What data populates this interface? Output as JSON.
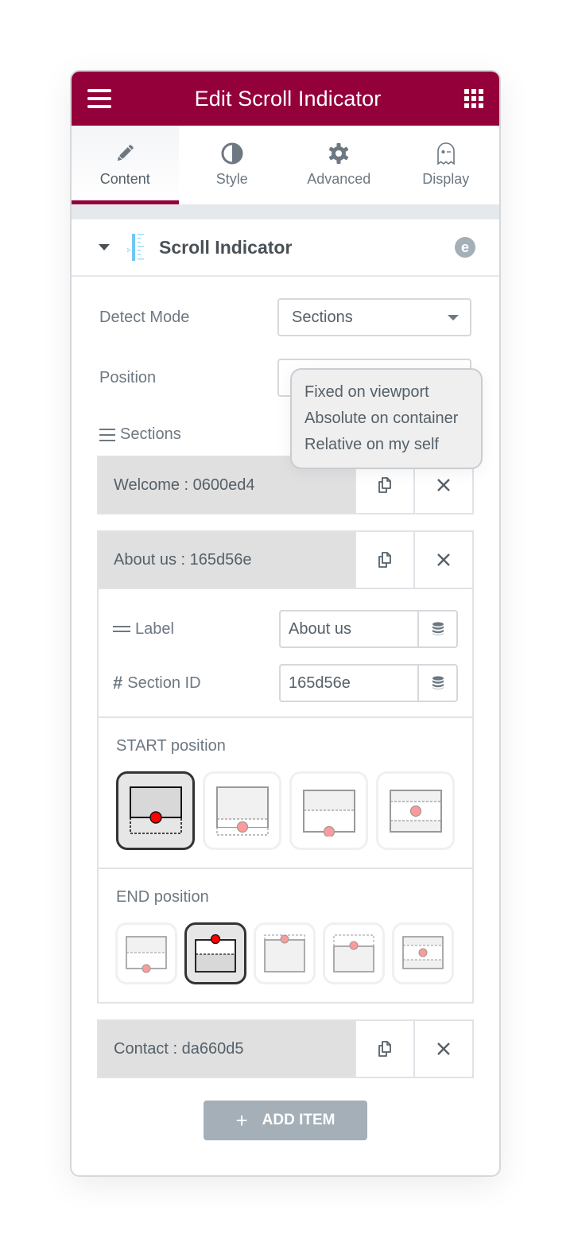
{
  "header": {
    "title": "Edit Scroll Indicator",
    "menu_icon": "hamburger-icon",
    "apps_icon": "grid-icon"
  },
  "tabs": [
    {
      "label": "Content",
      "icon": "pencil-icon",
      "active": true
    },
    {
      "label": "Style",
      "icon": "half-circle-icon",
      "active": false
    },
    {
      "label": "Advanced",
      "icon": "gear-icon",
      "active": false
    },
    {
      "label": "Display",
      "icon": "ghost-icon",
      "active": false
    }
  ],
  "widget": {
    "title": "Scroll Indicator",
    "badge": "e"
  },
  "controls": {
    "detect_mode": {
      "label": "Detect Mode",
      "value": "Sections"
    },
    "position": {
      "label": "Position",
      "options": [
        "Fixed on viewport",
        "Absolute on container",
        "Relative on my self"
      ]
    },
    "sections_label": "Sections"
  },
  "sections": [
    {
      "title": "Welcome : 0600ed4",
      "expanded": false
    },
    {
      "title": "About us : 165d56e",
      "expanded": true,
      "fields": {
        "label": {
          "label": "Label",
          "value": "About us"
        },
        "section_id": {
          "label": "Section ID",
          "value": "165d56e"
        }
      },
      "start_position": {
        "title": "START position",
        "options_count": 4,
        "selected_index": 0
      },
      "end_position": {
        "title": "END position",
        "options_count": 5,
        "selected_index": 1
      }
    },
    {
      "title": "Contact : da660d5",
      "expanded": false
    }
  ],
  "add_item": {
    "label": "ADD ITEM",
    "icon": "plus-icon"
  },
  "colors": {
    "brand": "#93003a",
    "button_gray": "#a4afb7",
    "marker_selected": "#ff0000",
    "marker": "#ff9a9a"
  }
}
